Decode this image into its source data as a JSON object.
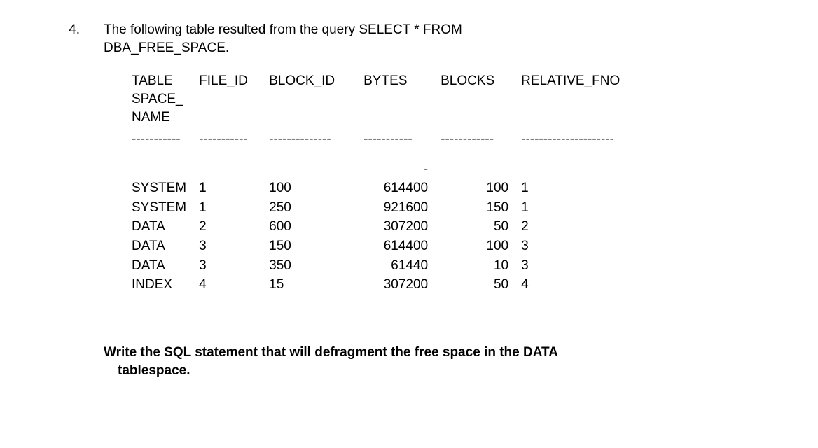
{
  "question_number": "4.",
  "intro_line1": "The following table resulted from the query SELECT * FROM",
  "intro_line2": "DBA_FREE_SPACE.",
  "headers": {
    "tablespace": "TABLE\nSPACE_\nNAME",
    "file_id": "FILE_ID",
    "block_id": "BLOCK_ID",
    "bytes": "BYTES",
    "blocks": "BLOCKS",
    "relative_fno": "RELATIVE_FNO"
  },
  "dashes": {
    "c1": "-----------",
    "c2": "-----------",
    "c3": "--------------",
    "c4": "-----------",
    "c5": "------------",
    "c6": "---------------------"
  },
  "pre_hyphen": "-",
  "rows": [
    {
      "tablespace": "SYSTEM",
      "file_id": "1",
      "block_id": "100",
      "bytes": "614400",
      "blocks": "100",
      "relative_fno": "1"
    },
    {
      "tablespace": "SYSTEM",
      "file_id": "1",
      "block_id": "250",
      "bytes": "921600",
      "blocks": "150",
      "relative_fno": "1"
    },
    {
      "tablespace": "DATA",
      "file_id": "2",
      "block_id": "600",
      "bytes": "307200",
      "blocks": "50",
      "relative_fno": "2"
    },
    {
      "tablespace": "DATA",
      "file_id": "3",
      "block_id": "150",
      "bytes": "614400",
      "blocks": "100",
      "relative_fno": "3"
    },
    {
      "tablespace": "DATA",
      "file_id": "3",
      "block_id": "350",
      "bytes": "61440",
      "blocks": "10",
      "relative_fno": "3"
    },
    {
      "tablespace": "INDEX",
      "file_id": "4",
      "block_id": "15",
      "bytes": "307200",
      "blocks": "50",
      "relative_fno": "4"
    }
  ],
  "prompt_line1": "Write the SQL statement that will defragment the free space in the DATA",
  "prompt_line2": "tablespace."
}
